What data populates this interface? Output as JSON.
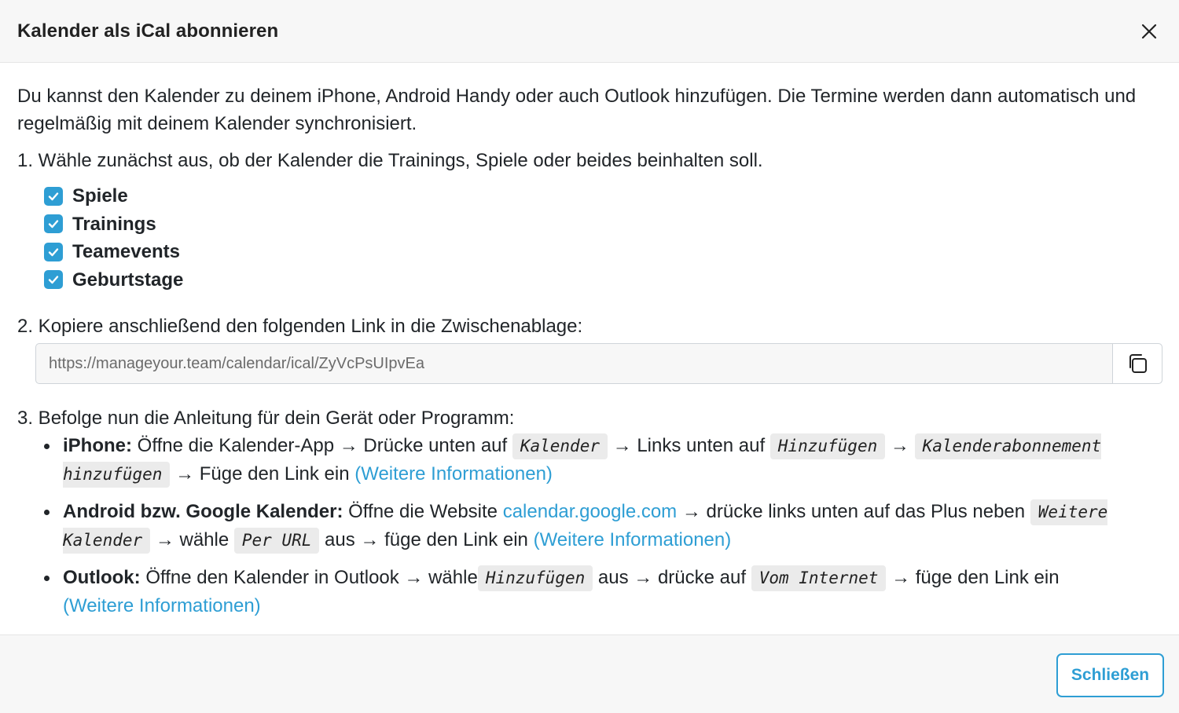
{
  "header": {
    "title": "Kalender als iCal abonnieren"
  },
  "body": {
    "intro": "Du kannst den Kalender zu deinem iPhone, Android Handy oder auch Outlook hinzufügen. Die Termine werden dann automatisch und regelmäßig mit deinem Kalender synchronisiert.",
    "step1": "1. Wähle zunächst aus, ob der Kalender die Trainings, Spiele oder beides beinhalten soll.",
    "checkboxes": [
      {
        "label": "Spiele",
        "checked": true
      },
      {
        "label": "Trainings",
        "checked": true
      },
      {
        "label": "Teamevents",
        "checked": true
      },
      {
        "label": "Geburtstage",
        "checked": true
      }
    ],
    "step2": "2. Kopiere anschließend den folgenden Link in die Zwischenablage:",
    "ical_link": "https://manageyour.team/calendar/ical/ZyVcPsUIpvEa",
    "step3": "3. Befolge nun die Anleitung für dein Gerät oder Programm:",
    "iphone": {
      "name": "iPhone:",
      "t1": " Öffne die Kalender-App → Drücke unten auf ",
      "k1": "Kalender",
      "t2": " → Links unten auf ",
      "k2": "Hinzufügen",
      "t3": " → ",
      "k3": "Kalenderabonnement hinzufügen",
      "t4": " → Füge den Link ein ",
      "more": "(Weitere Informationen)"
    },
    "android": {
      "name": "Android bzw. Google Kalender:",
      "t1": " Öffne die Website ",
      "site": "calendar.google.com",
      "t2": " → drücke links unten auf das Plus neben ",
      "k1": "Weitere Kalender",
      "t3": " → wähle ",
      "k2": "Per URL",
      "t4": " aus → füge den Link ein ",
      "more": "(Weitere Informationen)"
    },
    "outlook": {
      "name": "Outlook:",
      "t1": " Öffne den Kalender in Outlook → wähle",
      "k1": "Hinzufügen",
      "t2": " aus → drücke auf ",
      "k2": "Vom Internet",
      "t3": " → füge den Link ein ",
      "more": "(Weitere Informationen)"
    }
  },
  "footer": {
    "close_label": "Schließen"
  },
  "colors": {
    "accent": "#2e9ed4",
    "header_bg": "#f7f7f7"
  },
  "icons": {
    "close": "close-icon",
    "copy": "copy-icon",
    "check": "check-icon"
  }
}
